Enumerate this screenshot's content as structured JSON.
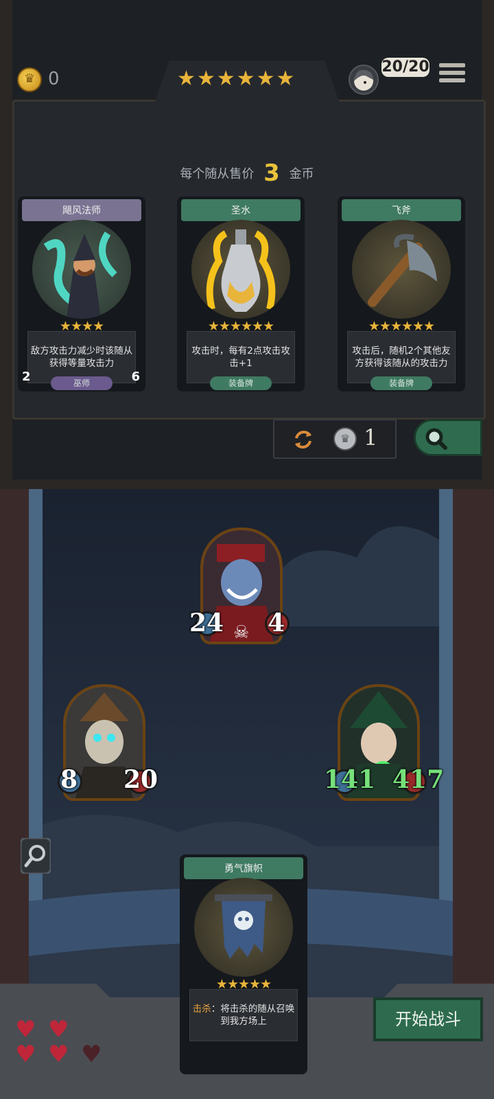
{
  "header": {
    "coin_count": "0",
    "rating_stars": "★★★★★★",
    "population": "20/20"
  },
  "shop": {
    "price_prefix": "每个随从售价",
    "price_value": "3",
    "price_suffix": "金币",
    "refresh_cost": "1",
    "cards": [
      {
        "title": "飓风法师",
        "stars": "★★★★",
        "desc": "敌方攻击力减少时该随从获得等量攻击力",
        "tag": "巫师",
        "attack": "2",
        "health": "6"
      },
      {
        "title": "圣水",
        "stars": "★★★★★★",
        "desc": "攻击时，每有2点攻击攻击+1",
        "tag": "装备牌"
      },
      {
        "title": "飞斧",
        "stars": "★★★★★★",
        "desc": "攻击后，随机2个其他友方获得该随从的攻击力",
        "tag": "装备牌"
      }
    ]
  },
  "board": {
    "minions": [
      {
        "attack": "24",
        "health": "4"
      },
      {
        "attack": "8",
        "health": "20"
      },
      {
        "attack": "141",
        "health": "417"
      }
    ],
    "hand_card": {
      "title": "勇气旗帜",
      "stars": "★★★★★",
      "desc_keyword": "击杀",
      "desc": "：将击杀的随从召唤到我方场上"
    },
    "start_button": "开始战斗",
    "hearts": {
      "filled": 4,
      "total": 5
    }
  },
  "colors": {
    "gold": "#e8b43a",
    "green": "#2e6b4e",
    "purple_header": "#7a7392",
    "green_header": "#3f7a62"
  }
}
